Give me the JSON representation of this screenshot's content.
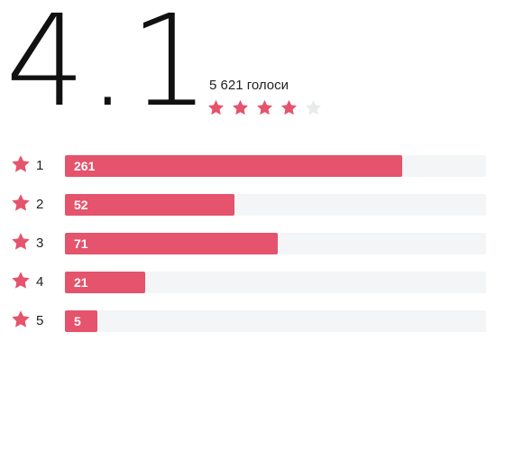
{
  "summary": {
    "score": "4.1",
    "votes_text": "5 621 голоси",
    "stars_filled": 4,
    "stars_total": 5
  },
  "colors": {
    "accent": "#e5536c",
    "track": "#f3f5f6",
    "star_empty": "#e8eaec"
  },
  "icons": {
    "row_icon": "star-icon",
    "rating_icon": "star-icon"
  },
  "breakdown": [
    {
      "star_label": "1",
      "count": "261",
      "fill_fraction": 0.8
    },
    {
      "star_label": "2",
      "count": "52",
      "fill_fraction": 0.402
    },
    {
      "star_label": "3",
      "count": "71",
      "fill_fraction": 0.505
    },
    {
      "star_label": "4",
      "count": "21",
      "fill_fraction": 0.19
    },
    {
      "star_label": "5",
      "count": "5",
      "fill_fraction": 0.077
    }
  ]
}
